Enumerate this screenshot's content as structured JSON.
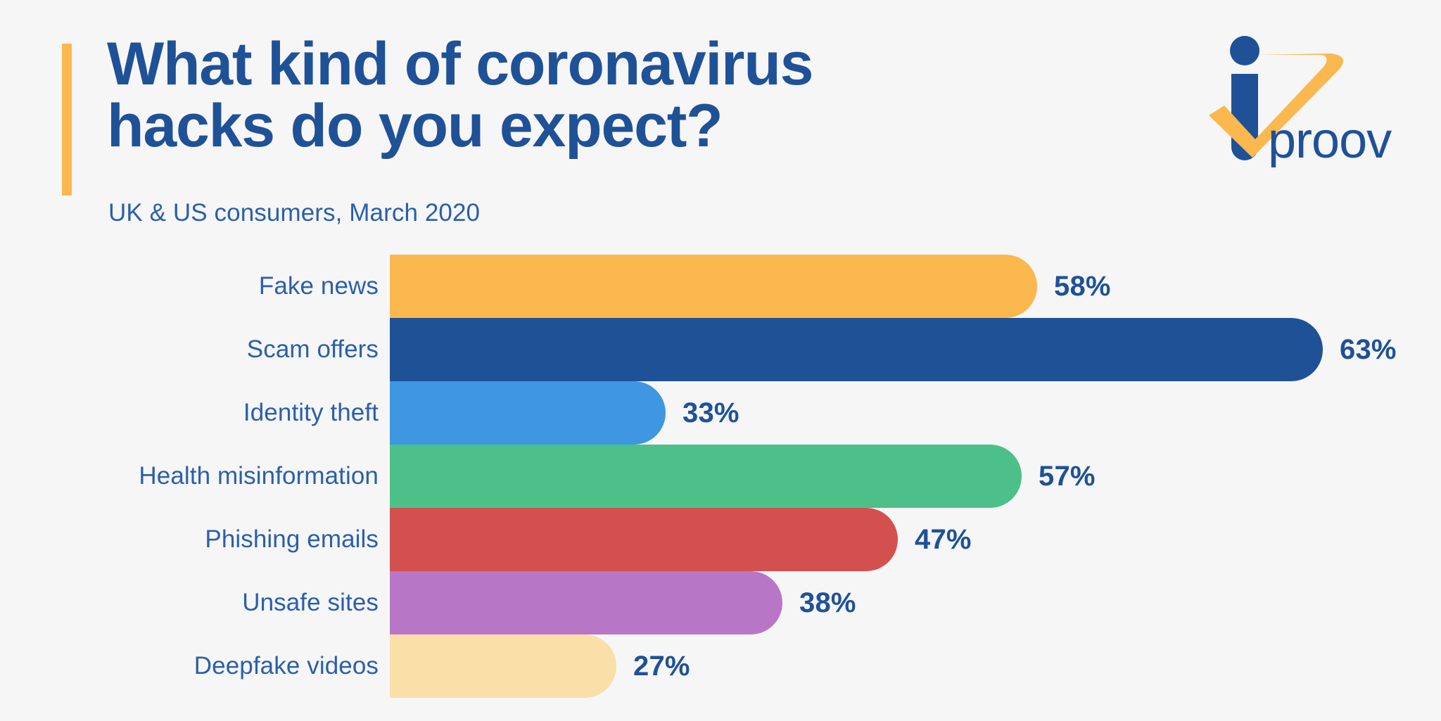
{
  "header": {
    "title": "What kind of coronavirus\nhacks do you expect?",
    "subtitle": "UK & US consumers, March 2020",
    "accent_color": "#fbb84f",
    "title_color": "#1f5197"
  },
  "logo": {
    "wordmark": "proov",
    "icon_name": "iproov-logo",
    "blue": "#1f5197",
    "orange": "#fbb84f"
  },
  "chart_data": {
    "type": "bar",
    "orientation": "horizontal",
    "title": "What kind of coronavirus hacks do you expect?",
    "subtitle": "UK & US consumers, March 2020",
    "xlabel": "",
    "ylabel": "",
    "xlim": [
      0,
      63
    ],
    "grid": false,
    "legend": false,
    "value_suffix": "%",
    "categories": [
      "Fake news",
      "Scam offers",
      "Identity theft",
      "Health misinformation",
      "Phishing emails",
      "Unsafe sites",
      "Deepfake videos"
    ],
    "values": [
      58,
      63,
      33,
      57,
      47,
      38,
      27
    ],
    "value_labels": [
      "58%",
      "63%",
      "33%",
      "57%",
      "47%",
      "38%",
      "27%"
    ],
    "colors": [
      "#fbb84f",
      "#1f5197",
      "#3e97e0",
      "#4cc088",
      "#d4504f",
      "#b877c6",
      "#fadfa8"
    ],
    "bars": [
      {
        "label": "Fake news",
        "value": 58,
        "display": "58%",
        "color": "#fbb84f"
      },
      {
        "label": "Scam offers",
        "value": 63,
        "display": "63%",
        "color": "#1f5197"
      },
      {
        "label": "Identity theft",
        "value": 33,
        "display": "33%",
        "color": "#3e97e0"
      },
      {
        "label": "Health misinformation",
        "value": 57,
        "display": "57%",
        "color": "#4cc088"
      },
      {
        "label": "Phishing emails",
        "value": 47,
        "display": "47%",
        "color": "#d4504f"
      },
      {
        "label": "Unsafe sites",
        "value": 38,
        "display": "38%",
        "color": "#b877c6"
      },
      {
        "label": "Deepfake videos",
        "value": 27,
        "display": "27%",
        "color": "#fadfa8"
      }
    ]
  },
  "background_color": "#f6f6f7"
}
